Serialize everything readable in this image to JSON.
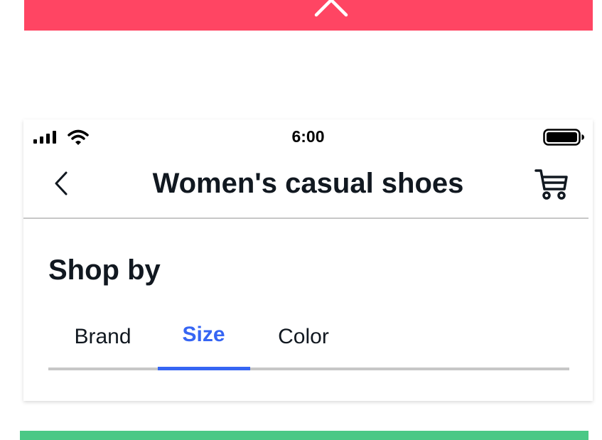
{
  "colors": {
    "red": "#ff4563",
    "green": "#4ac886",
    "blue": "#3665f3",
    "text": "#111820"
  },
  "top_banner": {
    "icon": "chevron-up-icon"
  },
  "status_bar": {
    "time": "6:00",
    "icons": [
      "cellular-signal-icon",
      "wifi-icon",
      "battery-icon"
    ]
  },
  "nav_bar": {
    "back_icon": "chevron-left-icon",
    "title": "Women's casual shoes",
    "cart_icon": "cart-icon"
  },
  "section": {
    "title": "Shop by"
  },
  "tabs": {
    "items": [
      {
        "label": "Brand"
      },
      {
        "label": "Size"
      },
      {
        "label": "Color"
      }
    ],
    "selected": "Size"
  }
}
